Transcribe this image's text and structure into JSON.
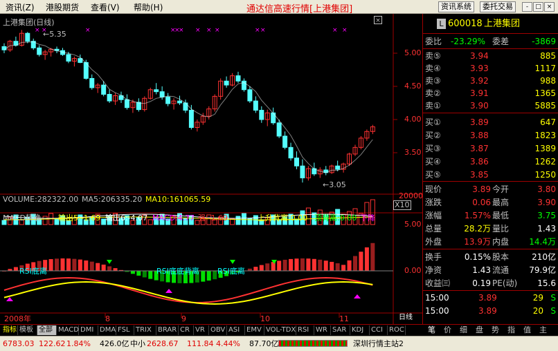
{
  "menu": [
    "资讯(Z)",
    "港股期货",
    "查看(V)",
    "帮助(H)"
  ],
  "app_title": "通达信高速行情[上港集团]",
  "toolbar_buttons": [
    "资讯系统",
    "委托交易"
  ],
  "window_buttons": [
    "-",
    "□",
    "×"
  ],
  "chart": {
    "title": "上港集团(日线)",
    "high_marker": "5.35",
    "low_marker": "3.05",
    "price_axis": [
      "5.00",
      "4.50",
      "4.00",
      "3.50"
    ],
    "markers": [
      "×",
      "××",
      "×",
      "×",
      "×××",
      "×",
      "×",
      "×",
      "××",
      "×",
      "×"
    ],
    "volume_label": "VOLUME:282322.00",
    "ma5_label": "MA5:206335.20",
    "ma10_label": "MA10:161065.59",
    "volume_axis": "20000",
    "volume_unit": "X10",
    "macd_title": "MACD精确",
    "macd_out5": "输出5:-1.69",
    "macd_out6": "输出6:-4.07",
    "macd_val": "MACD:4.77",
    "macd_strong": "强:-1.69",
    "rise_div": "上升背离:0.00",
    "top_div": "顶背离:0.00",
    "fall": "下降",
    "macd_axis": [
      "5.00",
      "0.00"
    ],
    "macd_annotations": [
      "RSI底离",
      "RSI底底背离",
      "RSI底离"
    ],
    "date_labels": [
      "2008年",
      "8",
      "9",
      "10",
      "11"
    ],
    "period": "日线"
  },
  "chart_data": {
    "type": "candlestick",
    "title": "上港集团(日线)",
    "ylim": [
      3.0,
      5.45
    ],
    "ohlc": [
      [
        5.1,
        5.15,
        5.0,
        5.05
      ],
      [
        5.05,
        5.2,
        5.02,
        5.18
      ],
      [
        5.18,
        5.25,
        5.1,
        5.12
      ],
      [
        5.12,
        5.35,
        5.1,
        5.3
      ],
      [
        5.3,
        5.32,
        5.15,
        5.18
      ],
      [
        5.18,
        5.22,
        5.05,
        5.08
      ],
      [
        5.08,
        5.12,
        4.95,
        4.98
      ],
      [
        4.98,
        5.05,
        4.9,
        5.02
      ],
      [
        5.02,
        5.08,
        4.95,
        5.06
      ],
      [
        5.06,
        5.1,
        5.0,
        5.04
      ],
      [
        5.04,
        5.08,
        4.96,
        4.98
      ],
      [
        4.98,
        5.02,
        4.85,
        4.88
      ],
      [
        4.88,
        4.95,
        4.8,
        4.92
      ],
      [
        4.92,
        4.98,
        4.85,
        4.86
      ],
      [
        4.86,
        4.9,
        4.6,
        4.62
      ],
      [
        4.62,
        4.68,
        4.45,
        4.48
      ],
      [
        4.48,
        4.55,
        4.4,
        4.52
      ],
      [
        4.52,
        4.58,
        4.35,
        4.38
      ],
      [
        4.38,
        4.45,
        4.25,
        4.28
      ],
      [
        4.28,
        4.4,
        4.22,
        4.36
      ],
      [
        4.36,
        4.42,
        4.25,
        4.3
      ],
      [
        4.3,
        4.38,
        4.15,
        4.18
      ],
      [
        4.18,
        4.3,
        4.1,
        4.26
      ],
      [
        4.26,
        4.32,
        4.12,
        4.15
      ],
      [
        4.15,
        4.35,
        4.12,
        4.32
      ],
      [
        4.32,
        4.48,
        4.3,
        4.45
      ],
      [
        4.45,
        4.55,
        4.38,
        4.42
      ],
      [
        4.42,
        4.5,
        4.3,
        4.34
      ],
      [
        4.34,
        4.4,
        4.2,
        4.24
      ],
      [
        4.24,
        4.32,
        4.15,
        4.28
      ],
      [
        4.28,
        4.36,
        4.22,
        4.25
      ],
      [
        4.25,
        4.3,
        4.1,
        4.14
      ],
      [
        4.14,
        4.22,
        3.85,
        3.88
      ],
      [
        3.88,
        4.0,
        3.82,
        3.96
      ],
      [
        3.96,
        4.1,
        3.92,
        4.05
      ],
      [
        4.05,
        4.2,
        4.0,
        4.16
      ],
      [
        4.16,
        4.38,
        4.12,
        4.35
      ],
      [
        4.35,
        4.62,
        4.3,
        4.58
      ],
      [
        4.58,
        4.65,
        4.48,
        4.52
      ],
      [
        4.52,
        4.7,
        4.5,
        4.66
      ],
      [
        4.66,
        4.72,
        4.55,
        4.58
      ],
      [
        4.58,
        4.62,
        4.42,
        4.45
      ],
      [
        4.45,
        4.5,
        4.25,
        4.28
      ],
      [
        4.28,
        4.35,
        4.1,
        4.14
      ],
      [
        4.14,
        4.2,
        3.95,
        4.0
      ],
      [
        4.0,
        4.15,
        3.9,
        4.1
      ],
      [
        4.1,
        4.18,
        3.92,
        3.95
      ],
      [
        3.95,
        4.0,
        3.72,
        3.75
      ],
      [
        3.75,
        3.82,
        3.55,
        3.58
      ],
      [
        3.58,
        3.65,
        3.38,
        3.42
      ],
      [
        3.42,
        3.52,
        3.25,
        3.3
      ],
      [
        3.3,
        3.4,
        3.05,
        3.12
      ],
      [
        3.12,
        3.3,
        3.08,
        3.26
      ],
      [
        3.26,
        3.35,
        3.15,
        3.18
      ],
      [
        3.18,
        3.28,
        3.12,
        3.24
      ],
      [
        3.24,
        3.3,
        3.16,
        3.2
      ],
      [
        3.2,
        3.32,
        3.18,
        3.3
      ],
      [
        3.3,
        3.38,
        3.22,
        3.25
      ],
      [
        3.25,
        3.35,
        3.2,
        3.33
      ],
      [
        3.33,
        3.5,
        3.3,
        3.48
      ],
      [
        3.48,
        3.62,
        3.45,
        3.58
      ],
      [
        3.58,
        3.75,
        3.55,
        3.72
      ],
      [
        3.72,
        3.85,
        3.68,
        3.82
      ],
      [
        3.82,
        3.92,
        3.78,
        3.89
      ]
    ]
  },
  "quote": {
    "code": "600018",
    "name": "上港集团",
    "badge": "L",
    "weibi_label": "委比",
    "weibi": "-23.29%",
    "weicha_label": "委差",
    "weicha": "-3869",
    "asks": [
      {
        "label": "卖⑤",
        "price": "3.94",
        "vol": "885"
      },
      {
        "label": "卖④",
        "price": "3.93",
        "vol": "1117"
      },
      {
        "label": "卖③",
        "price": "3.92",
        "vol": "988"
      },
      {
        "label": "卖②",
        "price": "3.91",
        "vol": "1365"
      },
      {
        "label": "卖①",
        "price": "3.90",
        "vol": "5885"
      }
    ],
    "bids": [
      {
        "label": "买①",
        "price": "3.89",
        "vol": "647"
      },
      {
        "label": "买②",
        "price": "3.88",
        "vol": "1823"
      },
      {
        "label": "买③",
        "price": "3.87",
        "vol": "1389"
      },
      {
        "label": "买④",
        "price": "3.86",
        "vol": "1262"
      },
      {
        "label": "买⑤",
        "price": "3.85",
        "vol": "1250"
      }
    ],
    "stats": [
      {
        "l1": "现价",
        "v1": "3.89",
        "l2": "今开",
        "v2": "3.80"
      },
      {
        "l1": "涨跌",
        "v1": "0.06",
        "l2": "最高",
        "v2": "3.90"
      },
      {
        "l1": "涨幅",
        "v1": "1.57%",
        "l2": "最低",
        "v2": "3.75"
      },
      {
        "l1": "总量",
        "v1": "28.2万",
        "l2": "量比",
        "v2": "1.43"
      },
      {
        "l1": "外盘",
        "v1": "13.9万",
        "l2": "内盘",
        "v2": "14.4万"
      }
    ],
    "fundamentals": [
      {
        "l1": "换手",
        "v1": "0.15%",
        "l2": "股本",
        "v2": "210亿"
      },
      {
        "l1": "净资",
        "v1": "1.43",
        "l2": "流通",
        "v2": "79.9亿"
      },
      {
        "l1": "收益㈢",
        "v1": "0.19",
        "l2": "PE(动)",
        "v2": "15.6"
      }
    ],
    "ticks": [
      {
        "time": "15:00",
        "price": "3.89",
        "vol": "29",
        "side": "S"
      },
      {
        "time": "15:00",
        "price": "3.89",
        "vol": "20",
        "side": "S"
      }
    ]
  },
  "tabs": [
    "指标",
    "模板",
    "全部",
    "MACD",
    "DMI",
    "DMA",
    "FSL",
    "TRIX",
    "BRAR",
    "CR",
    "VR",
    "OBV",
    "ASI",
    "EMV",
    "VOL-TDX",
    "RSI",
    "WR",
    "SAR",
    "KDJ",
    "CCI",
    "ROC"
  ],
  "panel_tabs": [
    "笔",
    "价",
    "细",
    "盘",
    "势",
    "指",
    "值",
    "主"
  ],
  "status": {
    "index1": "6783.03",
    "change1": "122.62",
    "pct1": "1.84%",
    "amount1": "426.0亿",
    "name2": "中小",
    "index2": "2628.67",
    "change2": "111.84",
    "pct2": "4.44%",
    "amount2": "87.70亿",
    "station": "深圳行情主站2"
  },
  "colors": {
    "up": "#ff3232",
    "down": "#54ffff",
    "label": "#c0c0c0",
    "yellow": "#ffff00",
    "magenta": "#ff00ff",
    "green": "#00e000",
    "cyan": "#00ffff"
  }
}
